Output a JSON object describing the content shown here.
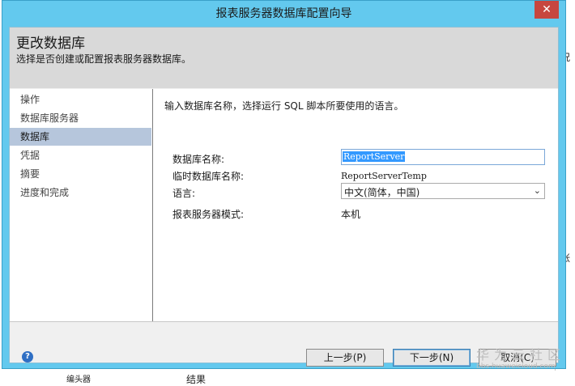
{
  "window": {
    "title": "报表服务器数据库配置向导",
    "close_glyph": "✕"
  },
  "header": {
    "title": "更改数据库",
    "subtitle": "选择是否创建或配置报表服务器数据库。"
  },
  "nav": {
    "items": [
      "操作",
      "数据库服务器",
      "数据库",
      "凭据",
      "摘要",
      "进度和完成"
    ],
    "active_index": 2
  },
  "content": {
    "instruction": "输入数据库名称，选择运行 SQL 脚本所要使用的语言。",
    "db_name_label": "数据库名称:",
    "db_name_value": "ReportServer",
    "temp_db_label": "临时数据库名称:",
    "temp_db_value": "ReportServerTemp",
    "language_label": "语言:",
    "language_value": "中文(简体，中国)",
    "mode_label": "报表服务器模式:",
    "mode_value": "本机"
  },
  "footer": {
    "help_glyph": "?",
    "back_label": "上一步(P)",
    "next_label": "下一步(N)",
    "cancel_label": "取消(C)"
  },
  "background": {
    "right_frag_1": "况",
    "right_frag_2": "帐",
    "bottom_frag_1": "结果",
    "bottom_frag_2": "编头器"
  },
  "watermark": {
    "brand": "华为云社区",
    "url": "bbs.huaweicloud.com"
  },
  "colors": {
    "titlebar": "#63c9ee",
    "selection": "#3399ff",
    "nav_active": "#b6c6dc",
    "close": "#c7463f"
  }
}
